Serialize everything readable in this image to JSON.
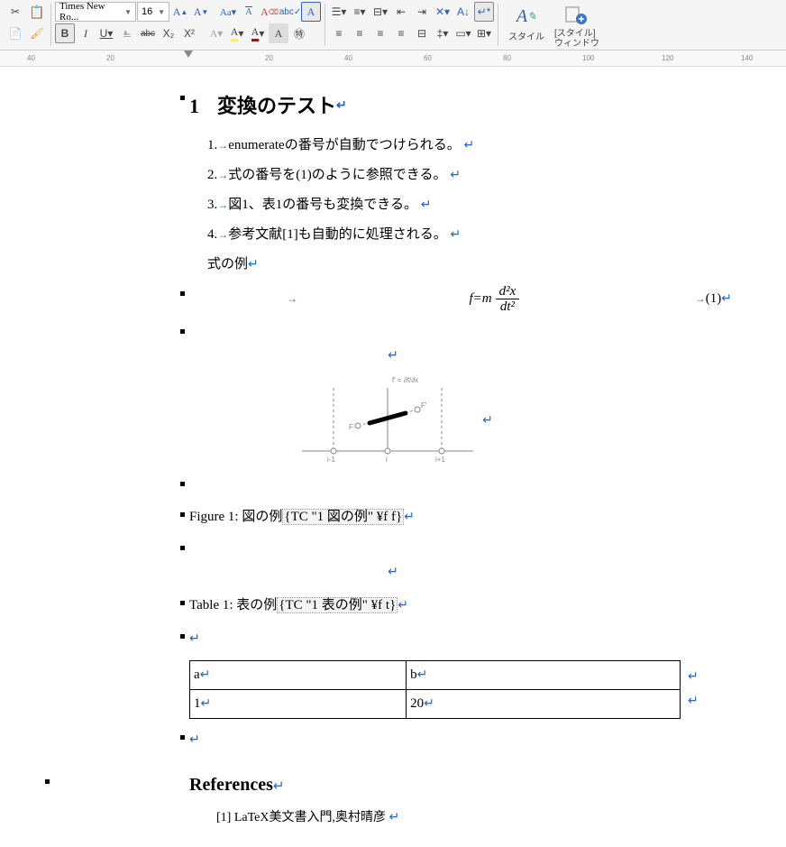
{
  "toolbar": {
    "font": "Times New Ro...",
    "size": "16",
    "bold": "B",
    "italic": "I",
    "underline": "U",
    "strike": "abc",
    "sub": "X₂",
    "sup": "X²",
    "style_label": "スタイル",
    "style_window_label": "[スタイル]\nウィンドウ"
  },
  "ruler": {
    "n0": "40",
    "n1": "20",
    "n2": "20",
    "n3": "40",
    "n4": "60",
    "n5": "80",
    "n6": "100",
    "n7": "120",
    "n8": "140"
  },
  "doc": {
    "h1_num": "1",
    "h1_text": "変換のテスト",
    "items": [
      {
        "num": "1.",
        "text": "enumerateの番号が自動でつけられる。"
      },
      {
        "num": "2.",
        "text": "式の番号を(1)のように参照できる。"
      },
      {
        "num": "3.",
        "text": "図1、表1の番号も変換できる。"
      },
      {
        "num": "4.",
        "text": "参考文献[1]も自動的に処理される。"
      }
    ],
    "eq_label": "式の例",
    "eq": {
      "lhs": "f=m",
      "num_top": "d²x",
      "num_bot": "dt²",
      "tag": "(1)"
    },
    "fig_annot": "f' = ∂f/∂x",
    "fig_labels": {
      "F": "F",
      "Fp": "F'",
      "im1": "i-1",
      "i": "i",
      "ip1": "i+1"
    },
    "figure_cap_prefix": "Figure 1:",
    "figure_cap_text": "図の例",
    "figure_field": "TC \"1  図の例\" ¥f f",
    "table_cap_prefix": "Table 1:",
    "table_cap_text": "表の例",
    "table_field": "TC \"1  表の例\" ¥f t",
    "table": {
      "h1": "a",
      "h2": "b",
      "c1": "1",
      "c2": "20"
    },
    "refs_title": "References",
    "ref1": "[1] LaTeX美文書入門,奥村晴彦"
  }
}
